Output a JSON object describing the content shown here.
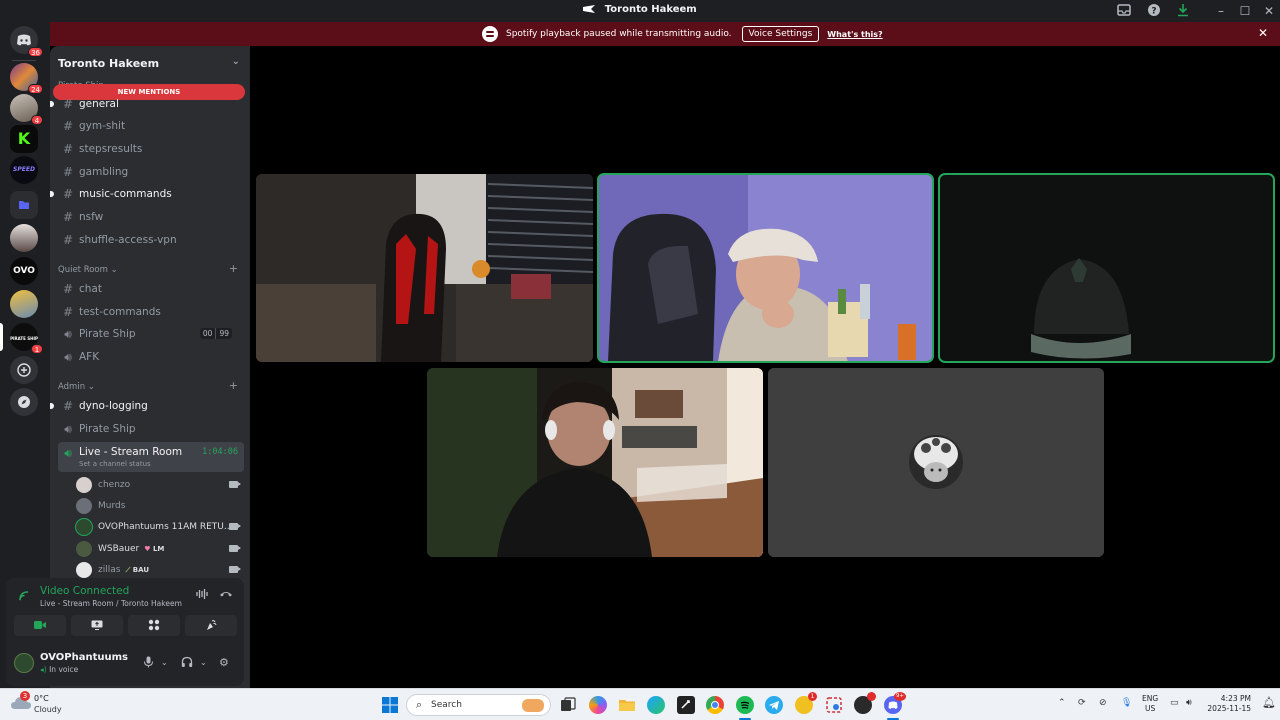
{
  "window": {
    "title": "Toronto Hakeem"
  },
  "notice": {
    "message": "Spotify playback paused while transmitting audio.",
    "button_label": "Voice Settings",
    "link_label": "What's this?"
  },
  "rail": {
    "home_badge": "36",
    "servers": [
      {
        "badge": "24"
      },
      {
        "badge": "4"
      },
      {
        "logo_text": "K"
      },
      {
        "logo_text": "SPEED"
      },
      {},
      {},
      {
        "logo_text": "OVO"
      },
      {},
      {
        "badge": "1",
        "logo_text": "PIRATE SHIP"
      }
    ]
  },
  "server": {
    "name": "Toronto Hakeem",
    "new_mentions": "NEW MENTIONS",
    "partial_category": "Pirate Ship",
    "channels_top": [
      {
        "name": "general",
        "unread": true
      },
      {
        "name": "gym-shit"
      },
      {
        "name": "stepsresults"
      },
      {
        "name": "gambling"
      },
      {
        "name": "music-commands",
        "unread": true
      },
      {
        "name": "nsfw"
      },
      {
        "name": "shuffle-access-vpn"
      }
    ],
    "cat_quiet": "Quiet Room",
    "quiet_channels": [
      {
        "name": "chat"
      },
      {
        "name": "test-commands"
      },
      {
        "name": "Pirate Ship",
        "cap_left": "00",
        "cap_right": "99"
      },
      {
        "name": "AFK"
      }
    ],
    "cat_admin": "Admin",
    "admin_channels": [
      {
        "name": "dyno-logging"
      },
      {
        "name": "Pirate Ship"
      }
    ],
    "active_channel": {
      "name": "Live - Stream Room",
      "timer": "1:04:06",
      "status": "Set a channel status"
    },
    "participants": [
      {
        "name": "chenzo"
      },
      {
        "name": "Murds"
      },
      {
        "name": "OVOPhantuums 11AM RETU..."
      },
      {
        "name": "WSBauer",
        "tag": "LM"
      },
      {
        "name": "zillas",
        "tag": "BAU"
      }
    ]
  },
  "voice": {
    "status": "Video Connected",
    "location": "Live - Stream Room / Toronto Hakeem"
  },
  "user": {
    "name": "OVOPhantuums",
    "status": "In voice"
  },
  "taskbar": {
    "temp": "0°C",
    "condition": "Cloudy",
    "weather_badge": "3",
    "search_placeholder": "Search",
    "lang_line1": "ENG",
    "lang_line2": "US",
    "time": "4:23 PM",
    "date": "2025-11-15",
    "discord_badge": "9+"
  },
  "colors": {
    "speaking": "#23a55a",
    "mention": "#da373c",
    "notice_bg": "#5c0e18"
  }
}
